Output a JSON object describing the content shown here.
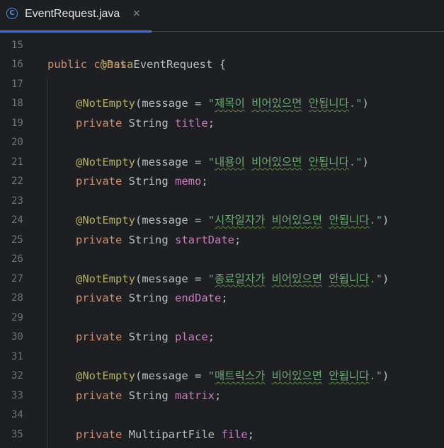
{
  "tab": {
    "icon": "C",
    "filename": "EventRequest.java",
    "close": "×"
  },
  "line_numbers": [
    "15",
    "16",
    "17",
    "18",
    "19",
    "20",
    "21",
    "22",
    "23",
    "24",
    "25",
    "26",
    "27",
    "28",
    "29",
    "30",
    "31",
    "32",
    "33",
    "34",
    "35"
  ],
  "code": {
    "l15": {
      "annotation": "@Data"
    },
    "l16": {
      "kw1": "public",
      "kw2": "class",
      "name": "EventRequest",
      "brace": "{"
    },
    "l18": {
      "annotation": "@NotEmpty",
      "pre": "(message = ",
      "q1": "\"",
      "s1": "제목이",
      "s2": "비어있으면",
      "s3": "안됩니다",
      "q2": ".\"",
      "post": ")"
    },
    "l19": {
      "kw": "private",
      "type": "String",
      "field": "title",
      "semi": ";"
    },
    "l21": {
      "annotation": "@NotEmpty",
      "pre": "(message = ",
      "q1": "\"",
      "s1": "내용이",
      "s2": "비어있으면",
      "s3": "안됩니다",
      "q2": ".\"",
      "post": ")"
    },
    "l22": {
      "kw": "private",
      "type": "String",
      "field": "memo",
      "semi": ";"
    },
    "l24": {
      "annotation": "@NotEmpty",
      "pre": "(message = ",
      "q1": "\"",
      "s1": "시작일자가",
      "s2": "비어있으면",
      "s3": "안됩니다",
      "q2": ".\"",
      "post": ")"
    },
    "l25": {
      "kw": "private",
      "type": "String",
      "field": "startDate",
      "semi": ";"
    },
    "l27": {
      "annotation": "@NotEmpty",
      "pre": "(message = ",
      "q1": "\"",
      "s1": "종료일자가",
      "s2": "비어있으면",
      "s3": "안됩니다",
      "q2": ".\"",
      "post": ")"
    },
    "l28": {
      "kw": "private",
      "type": "String",
      "field": "endDate",
      "semi": ";"
    },
    "l30": {
      "kw": "private",
      "type": "String",
      "field": "place",
      "semi": ";"
    },
    "l32": {
      "annotation": "@NotEmpty",
      "pre": "(message = ",
      "q1": "\"",
      "s1": "매트릭스가",
      "s2": "비어있으면",
      "s3": "안됩니다",
      "q2": ".\"",
      "post": ")"
    },
    "l33": {
      "kw": "private",
      "type": "String",
      "field": "matrix",
      "semi": ";"
    },
    "l35": {
      "kw": "private",
      "type": "MultipartFile",
      "field": "file",
      "semi": ";"
    }
  },
  "colors": {
    "background": "#1e1f22",
    "annotation": "#b3ae60",
    "keyword": "#cf8e6d",
    "field": "#c77dbb",
    "string": "#6aab73",
    "text": "#bcbec4",
    "line_number": "#6f737a",
    "tab_accent": "#3574f0",
    "class_icon": "#4f8ce9"
  }
}
